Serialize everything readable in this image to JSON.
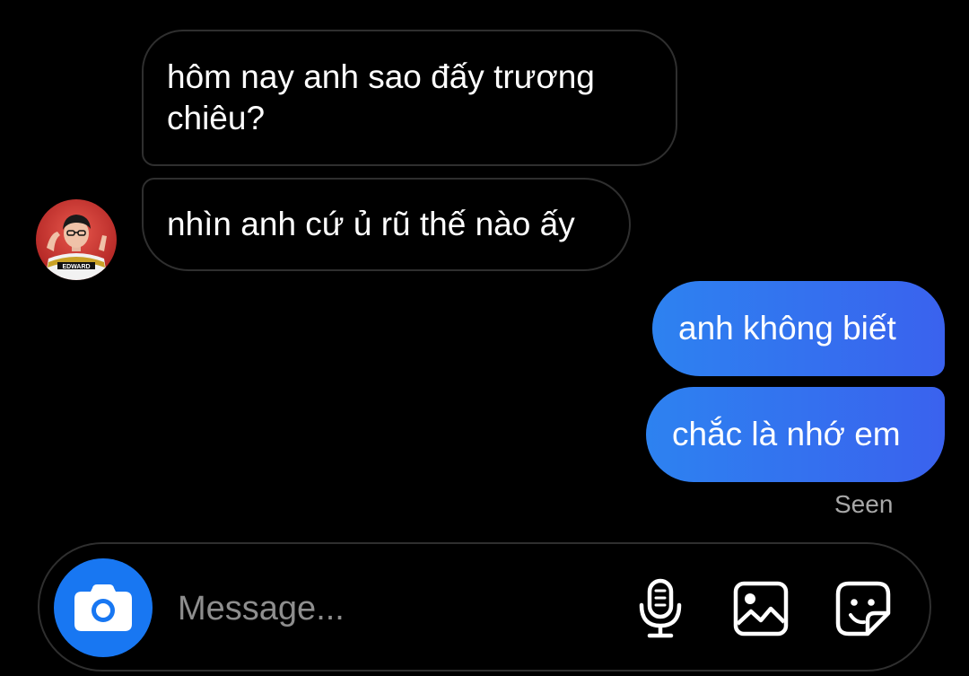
{
  "conversation": {
    "messages": [
      {
        "direction": "incoming",
        "text": "hôm nay anh sao đấy trương chiêu?"
      },
      {
        "direction": "incoming",
        "text": "nhìn anh cứ ủ rũ thế nào ấy"
      },
      {
        "direction": "outgoing",
        "text": "anh không biết"
      },
      {
        "direction": "outgoing",
        "text": "chắc là nhớ em"
      }
    ],
    "seen_label": "Seen",
    "avatar_jersey_text": "EDWARD"
  },
  "composer": {
    "placeholder": "Message...",
    "icons": {
      "camera": "camera-icon",
      "mic": "microphone-icon",
      "gallery": "image-icon",
      "sticker": "sticker-icon"
    }
  },
  "colors": {
    "background": "#000000",
    "outgoing_bubble_start": "#2d82f0",
    "outgoing_bubble_end": "#3a62ee",
    "incoming_border": "#2f2f2f",
    "camera_button": "#1877f2",
    "seen_text": "#a8a8a8"
  }
}
